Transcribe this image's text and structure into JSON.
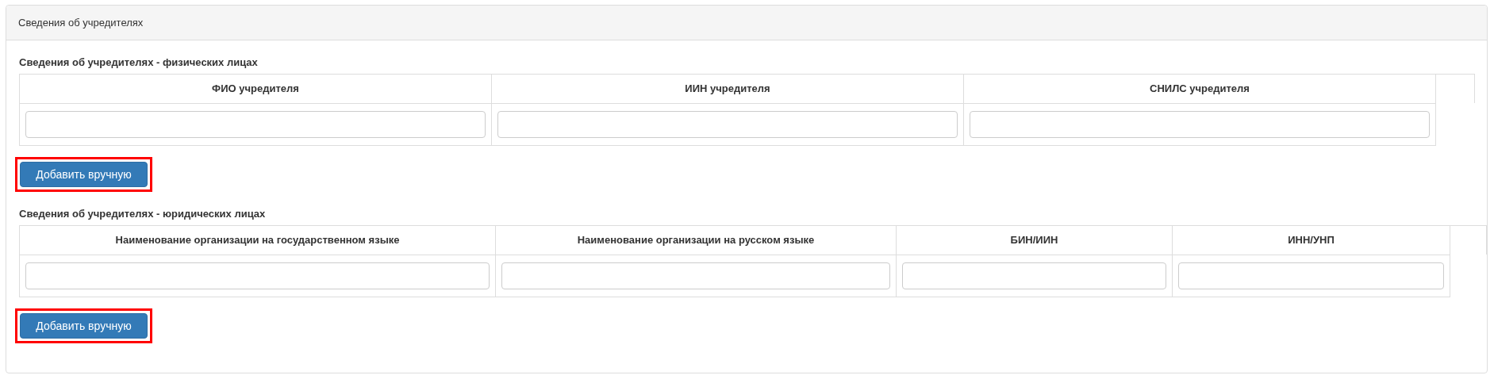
{
  "panel": {
    "title": "Сведения об учредителях"
  },
  "sections": [
    {
      "title": "Сведения об учредителях - физических лицах",
      "columns": [
        "ФИО учредителя",
        "ИИН учредителя",
        "СНИЛС учредителя"
      ],
      "button": {
        "label": "Добавить вручную",
        "highlighted": true
      }
    },
    {
      "title": "Сведения об учредителях - юридических лицах",
      "columns": [
        "Наименование организации на государственном языке",
        "Наименование организации на русском языке",
        "БИН/ИИН",
        "ИНН/УНП"
      ],
      "button": {
        "label": "Добавить вручную",
        "highlighted": true
      }
    }
  ]
}
